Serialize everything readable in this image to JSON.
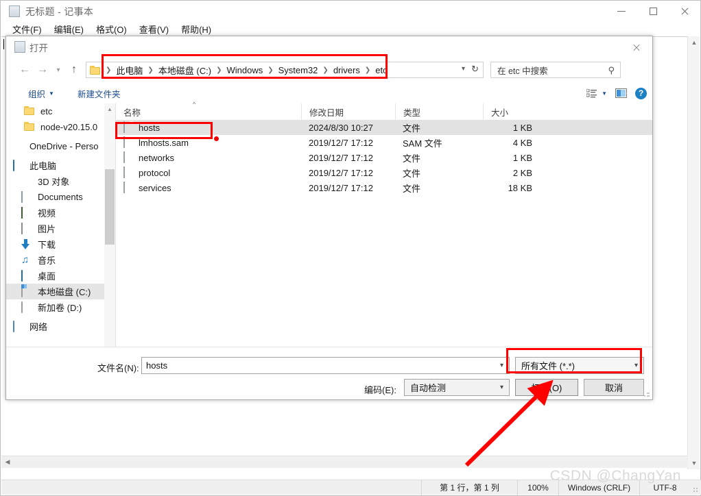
{
  "notepad": {
    "title": "无题 - 记事本",
    "title_text": "无标题 - 记事本",
    "icon": "notepad-icon",
    "menus": [
      {
        "label": "文件(F)"
      },
      {
        "label": "编辑(E)"
      },
      {
        "label": "格式(O)"
      },
      {
        "label": "查看(V)"
      },
      {
        "label": "帮助(H)"
      }
    ],
    "caption": {
      "minimize": "minimize-icon",
      "maximize": "maximize-icon",
      "close": "close-icon"
    },
    "status": {
      "position": "第 1 行，第 1 列",
      "zoom": "100%",
      "line_ending": "Windows (CRLF)",
      "encoding": "UTF-8"
    },
    "watermark": "CSDN @ChangYan"
  },
  "dialog": {
    "title": "打开",
    "icon": "notepad-icon",
    "close_icon": "close-icon",
    "nav": {
      "back_icon": "arrow-left-icon",
      "forward_icon": "arrow-right-icon",
      "recent_icon": "chevron-down-icon",
      "up_icon": "arrow-up-icon",
      "folder_icon": "folder-icon",
      "breadcrumbs": [
        "此电脑",
        "本地磁盘 (C:)",
        "Windows",
        "System32",
        "drivers",
        "etc"
      ],
      "dropdown_icon": "chevron-down-icon",
      "refresh_icon": "refresh-icon"
    },
    "search": {
      "placeholder": "在 etc 中搜索",
      "icon": "search-icon"
    },
    "commandbar": {
      "organize": "组织",
      "organize_caret": "▾",
      "new_folder": "新建文件夹",
      "view_icon": "view-list-icon",
      "view_caret": "▾",
      "preview_pane_icon": "preview-pane-icon",
      "help_icon": "help-icon"
    },
    "tree": {
      "items": [
        {
          "label": "etc",
          "icon": "folder-icon",
          "indent": "l2",
          "selected": false
        },
        {
          "label": "node-v20.15.0",
          "icon": "folder-icon",
          "indent": "l2",
          "selected": false
        },
        {
          "label": "OneDrive - Perso",
          "icon": "onedrive-icon",
          "indent": "l1",
          "selected": false
        },
        {
          "label": "此电脑",
          "icon": "pc-icon",
          "indent": "l1",
          "selected": false
        },
        {
          "label": "3D 对象",
          "icon": "3d-objects-icon",
          "indent": "l3",
          "selected": false
        },
        {
          "label": "Documents",
          "icon": "documents-icon",
          "indent": "l3",
          "selected": false
        },
        {
          "label": "视频",
          "icon": "videos-icon",
          "indent": "l3",
          "selected": false
        },
        {
          "label": "图片",
          "icon": "pictures-icon",
          "indent": "l3",
          "selected": false
        },
        {
          "label": "下载",
          "icon": "downloads-icon",
          "indent": "l3",
          "selected": false
        },
        {
          "label": "音乐",
          "icon": "music-icon",
          "indent": "l3",
          "selected": false
        },
        {
          "label": "桌面",
          "icon": "desktop-icon",
          "indent": "l3",
          "selected": false
        },
        {
          "label": "本地磁盘 (C:)",
          "icon": "local-disk-icon",
          "indent": "l3",
          "selected": true
        },
        {
          "label": "新加卷 (D:)",
          "icon": "disk-icon",
          "indent": "l3",
          "selected": false
        },
        {
          "label": "网络",
          "icon": "network-icon",
          "indent": "l1",
          "selected": false
        }
      ],
      "scroll_up_icon": "chevron-up-icon",
      "scroll_down_icon": "chevron-down-icon"
    },
    "filelist": {
      "columns": [
        "名称",
        "修改日期",
        "类型",
        "大小"
      ],
      "sort_caret": "⌃",
      "rows": [
        {
          "name": "hosts",
          "date": "2024/8/30 10:27",
          "type": "文件",
          "size": "1 KB",
          "selected": true
        },
        {
          "name": "lmhosts.sam",
          "date": "2019/12/7 17:12",
          "type": "SAM 文件",
          "size": "4 KB",
          "selected": false
        },
        {
          "name": "networks",
          "date": "2019/12/7 17:12",
          "type": "文件",
          "size": "1 KB",
          "selected": false
        },
        {
          "name": "protocol",
          "date": "2019/12/7 17:12",
          "type": "文件",
          "size": "2 KB",
          "selected": false
        },
        {
          "name": "services",
          "date": "2019/12/7 17:12",
          "type": "文件",
          "size": "18 KB",
          "selected": false
        }
      ]
    },
    "bottom": {
      "filename_label": "文件名(N):",
      "filename_value": "hosts",
      "filter_value": "所有文件 (*.*)",
      "encoding_label": "编码(E):",
      "encoding_value": "自动检测",
      "open_button": "打开(O)",
      "cancel_button": "取消",
      "caret_icon": "chevron-down-icon"
    }
  },
  "annotations": {
    "color": "#ff0000",
    "breadcrumb_box": "highlight-breadcrumb-path",
    "hosts_box": "highlight-hosts-file",
    "filter_box": "highlight-file-filter",
    "open_arrow": "arrow-pointing-to-open-button",
    "dot": "red-dot-marker"
  }
}
